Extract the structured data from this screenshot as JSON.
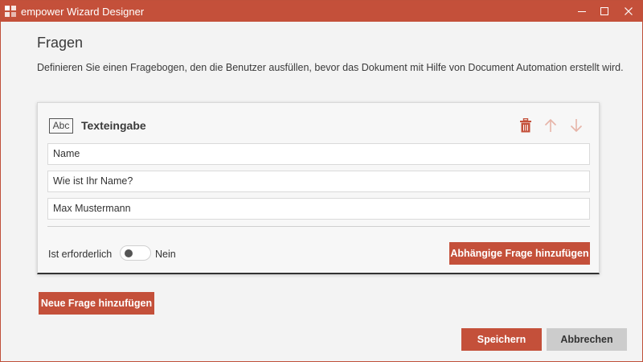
{
  "window": {
    "title": "empower Wizard Designer",
    "accent_color": "#c4503a"
  },
  "page": {
    "title": "Fragen",
    "description": "Definieren Sie einen Fragebogen, den die Benutzer ausfüllen, bevor das Dokument mit Hilfe von Document Automation erstellt wird."
  },
  "question_card": {
    "type_icon_text": "Abc",
    "type_label": "Texteingabe",
    "fields": [
      {
        "value": "Name"
      },
      {
        "value": "Wie ist Ihr Name?"
      },
      {
        "value": "Max Mustermann"
      }
    ],
    "required_label": "Ist erforderlich",
    "required_state_text": "Nein",
    "required": false,
    "add_dependent_label": "Abhängige Frage hinzufügen",
    "actions": [
      "delete-icon",
      "arrow-up-icon",
      "arrow-down-icon"
    ]
  },
  "add_question_label": "Neue Frage hinzufügen",
  "footer": {
    "save_label": "Speichern",
    "cancel_label": "Abbrechen"
  }
}
